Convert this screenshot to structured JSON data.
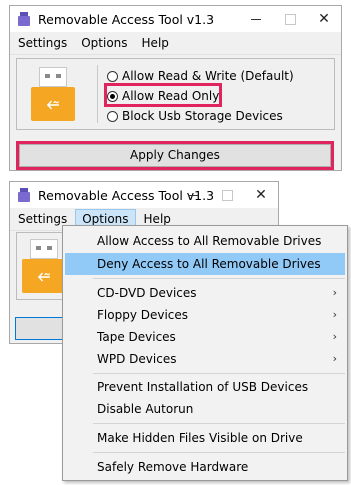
{
  "window1": {
    "title": "Removable Access Tool v1.3",
    "menu": [
      "Settings",
      "Options",
      "Help"
    ],
    "radios": [
      {
        "label": "Allow Read & Write (Default)",
        "selected": false
      },
      {
        "label": "Allow Read Only",
        "selected": true
      },
      {
        "label": "Block Usb Storage Devices",
        "selected": false
      }
    ],
    "apply_label": "Apply Changes",
    "close_glyph": "✕",
    "usb_symbol": "⭉"
  },
  "window2": {
    "title": "Removable Access Tool v1.3",
    "menu": [
      "Settings",
      "Options",
      "Help"
    ],
    "active_menu": "Options",
    "close_glyph": "✕",
    "usb_symbol": "⭉"
  },
  "options_menu": {
    "items": [
      {
        "label": "Allow Access to All Removable Drives",
        "submenu": false
      },
      {
        "label": "Deny Access to All Removable Drives",
        "submenu": false,
        "highlighted": true
      },
      {
        "label": "CD-DVD Devices",
        "submenu": true
      },
      {
        "label": "Floppy Devices",
        "submenu": true
      },
      {
        "label": "Tape Devices",
        "submenu": true
      },
      {
        "label": "WPD Devices",
        "submenu": true
      },
      {
        "label": "Prevent Installation of USB Devices",
        "submenu": false
      },
      {
        "label": "Disable Autorun",
        "submenu": false
      },
      {
        "label": "Make Hidden Files Visible on Drive",
        "submenu": false
      },
      {
        "label": "Safely Remove Hardware",
        "submenu": false
      }
    ],
    "submenu_arrow": "›"
  },
  "colors": {
    "highlight_border": "#e0245e",
    "menu_hover": "#91c9f7",
    "usb_body": "#f5a623",
    "app_icon": "#7a6ad0"
  },
  "icons": [
    "app-icon",
    "usb-drive-icon",
    "minimize-icon",
    "maximize-icon",
    "close-icon",
    "chevron-right-icon"
  ]
}
